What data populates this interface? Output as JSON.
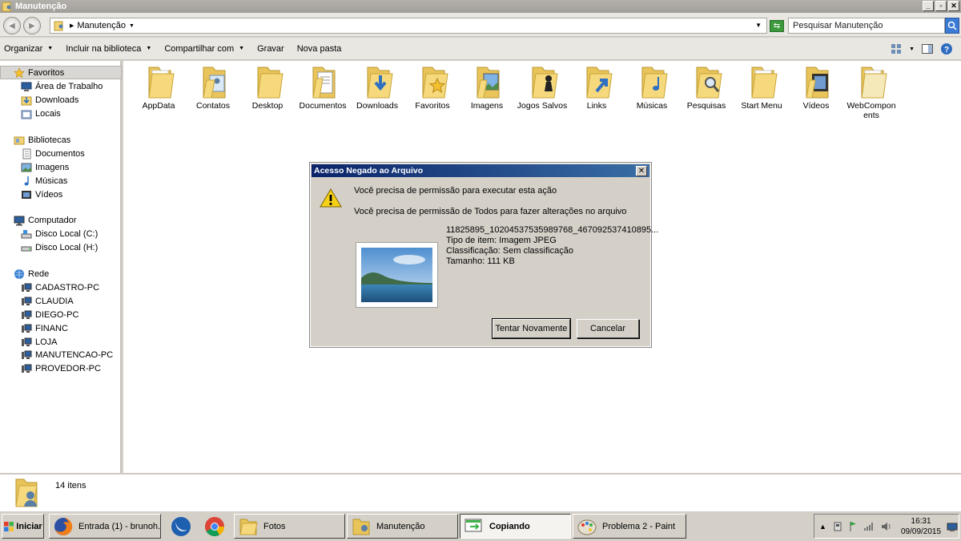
{
  "window": {
    "title": "Manutenção",
    "min": "_",
    "max": "▫",
    "close": "✕"
  },
  "address": {
    "path": "Manutenção",
    "search_placeholder": "Pesquisar Manutenção"
  },
  "toolbar": {
    "items": [
      "Organizar",
      "Incluir na biblioteca",
      "Compartilhar com",
      "Gravar",
      "Nova pasta"
    ]
  },
  "sidebar": {
    "favorites_header": "Favoritos",
    "favorites": [
      "Área de Trabalho",
      "Downloads",
      "Locais"
    ],
    "libraries_header": "Bibliotecas",
    "libraries": [
      "Documentos",
      "Imagens",
      "Músicas",
      "Vídeos"
    ],
    "computer_header": "Computador",
    "drives": [
      "Disco Local (C:)",
      "Disco Local (H:)"
    ],
    "network_header": "Rede",
    "network": [
      "CADASTRO-PC",
      "CLAUDIA",
      "DIEGO-PC",
      "FINANC",
      "LOJA",
      "MANUTENCAO-PC",
      "PROVEDOR-PC"
    ]
  },
  "folders": [
    "AppData",
    "Contatos",
    "Desktop",
    "Documentos",
    "Downloads",
    "Favoritos",
    "Imagens",
    "Jogos Salvos",
    "Links",
    "Músicas",
    "Pesquisas",
    "Start Menu",
    "Vídeos",
    "WebCompon ents"
  ],
  "status": {
    "count": "14 itens"
  },
  "dialog": {
    "title": "Acesso Negado ao Arquivo",
    "close": "✕",
    "message1": "Você precisa de permissão para executar esta ação",
    "message2": "Você precisa de permissão de Todos para fazer alterações no arquivo",
    "file_name": "11825895_10204537535989768_467092537410895...",
    "file_type": "Tipo de item: Imagem JPEG",
    "file_rating": "Classificação: Sem classificação",
    "file_size": "Tamanho: 111 KB",
    "retry_label": "Tentar Novamente",
    "cancel_label": "Cancelar"
  },
  "taskbar": {
    "start_label": "Iniciar",
    "buttons": [
      "Entrada (1) - brunoh...",
      "Fotos",
      "Manutenção",
      "Copiando",
      "Problema 2 - Paint"
    ],
    "active_button": "Copiando",
    "time": "16:31",
    "date": "09/09/2015"
  },
  "colors": {
    "dialog_title_start": "#0a246a",
    "dialog_title_end": "#3a6ea5",
    "folder": "#f2d475",
    "chrome": "#d4d0c8"
  }
}
